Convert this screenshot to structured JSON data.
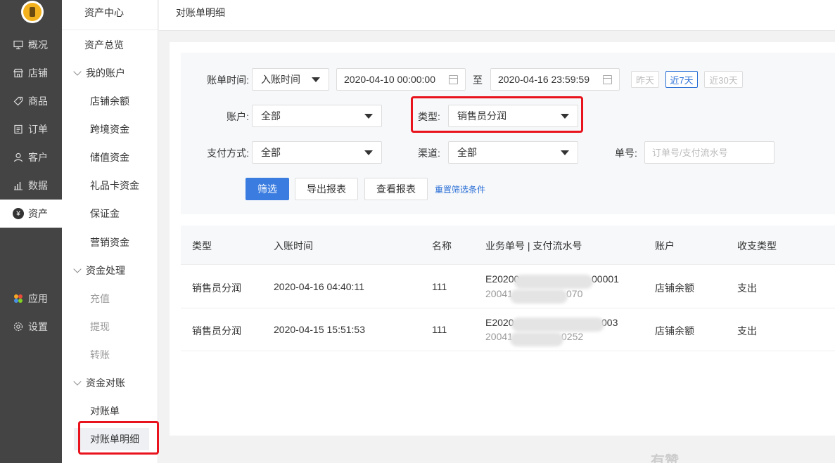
{
  "nav": {
    "items": [
      {
        "label": "概况",
        "icon": "monitor-icon"
      },
      {
        "label": "店铺",
        "icon": "store-icon"
      },
      {
        "label": "商品",
        "icon": "tag-icon"
      },
      {
        "label": "订单",
        "icon": "document-icon"
      },
      {
        "label": "客户",
        "icon": "user-icon"
      },
      {
        "label": "数据",
        "icon": "bar-chart-icon"
      },
      {
        "label": "资产",
        "icon": "yen-icon"
      },
      {
        "label": "应用",
        "icon": "apps-icon"
      },
      {
        "label": "设置",
        "icon": "gear-icon"
      }
    ]
  },
  "subnav": {
    "title": "资产中心",
    "overview": "资产总览",
    "group_my_accounts": "我的账户",
    "store_balance": "店铺余额",
    "cross_border": "跨境资金",
    "stored_value": "储值资金",
    "gift_card": "礼品卡资金",
    "deposit": "保证金",
    "marketing": "营销资金",
    "group_processing": "资金处理",
    "recharge": "充值",
    "withdraw": "提现",
    "transfer": "转账",
    "group_reconcile": "资金对账",
    "statement": "对账单",
    "statement_detail": "对账单明细"
  },
  "header": {
    "breadcrumb": "对账单明细"
  },
  "filters": {
    "bill_time_label": "账单时间:",
    "bill_time_type": "入账时间",
    "start_date": "2020-04-10 00:00:00",
    "to": "至",
    "end_date": "2020-04-16 23:59:59",
    "quick_yesterday": "昨天",
    "quick_7days": "近7天",
    "quick_30days": "近30天",
    "account_label": "账户:",
    "account_value": "全部",
    "type_label": "类型:",
    "type_value": "销售员分润",
    "pay_method_label": "支付方式:",
    "pay_method_value": "全部",
    "channel_label": "渠道:",
    "channel_value": "全部",
    "order_no_label": "单号:",
    "order_no_placeholder": "订单号/支付流水号",
    "btn_filter": "筛选",
    "btn_export": "导出报表",
    "btn_view": "查看报表",
    "link_reset": "重置筛选条件"
  },
  "table": {
    "headers": [
      "类型",
      "入账时间",
      "名称",
      "业务单号 | 支付流水号",
      "账户",
      "收支类型"
    ],
    "rows": [
      {
        "type": "销售员分润",
        "time": "2020-04-16 04:40:11",
        "name": "111",
        "biz_prefix": "E20200",
        "biz_suffix": "00001",
        "pay_prefix": "20041",
        "pay_suffix": "070",
        "account": "店铺余额",
        "io": "支出"
      },
      {
        "type": "销售员分润",
        "time": "2020-04-15 15:51:53",
        "name": "111",
        "biz_prefix": "E2020",
        "biz_suffix": "003",
        "pay_prefix": "20041",
        "pay_suffix": "0252",
        "account": "店铺余额",
        "io": "支出"
      }
    ]
  },
  "watermark": "有赞",
  "colors": {
    "highlight_red": "#e8131c",
    "primary_blue": "#3a7ce0",
    "nav_dark": "#444444"
  }
}
